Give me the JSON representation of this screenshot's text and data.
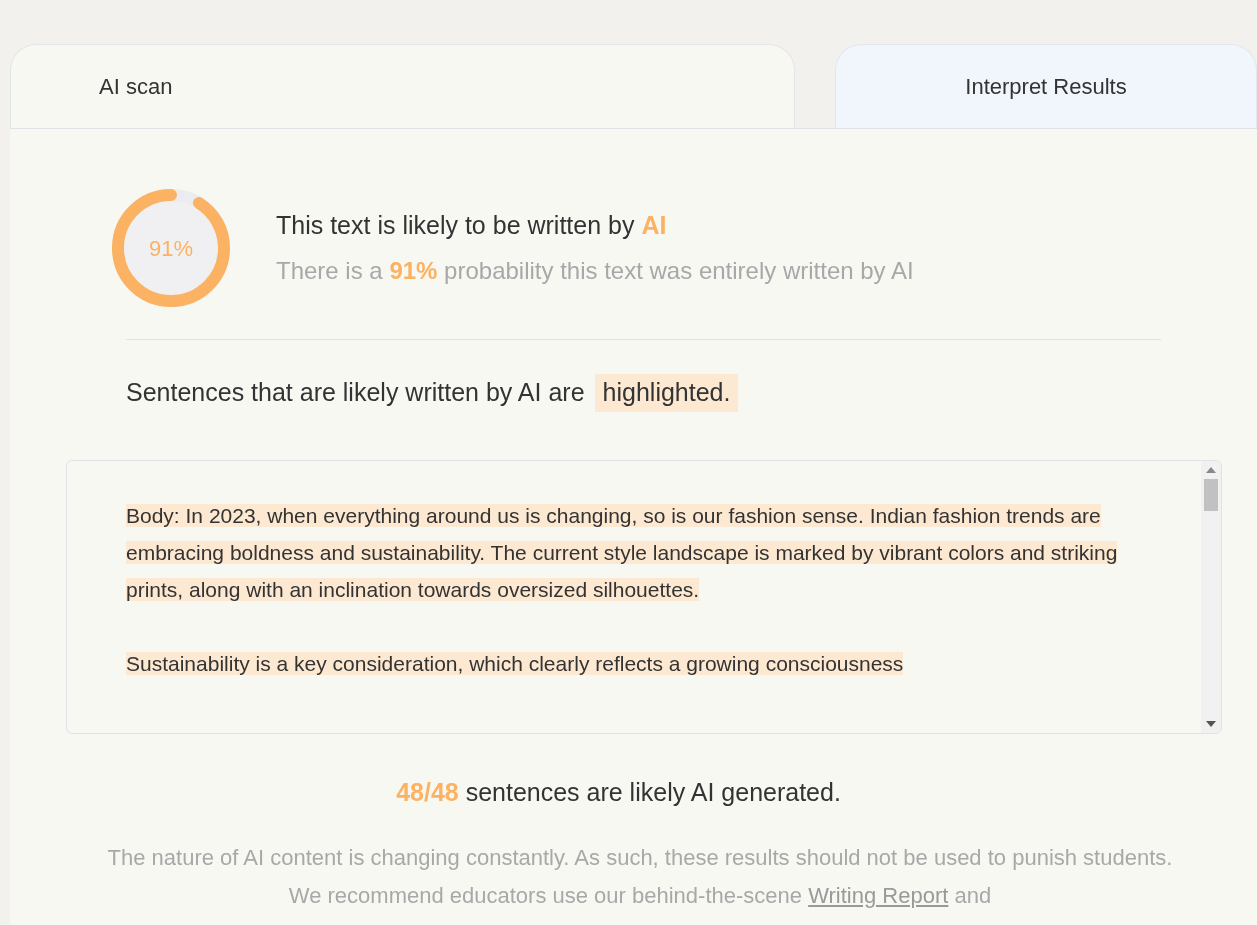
{
  "tabs": [
    {
      "label": "AI scan",
      "selected": true
    },
    {
      "label": "Interpret Results",
      "selected": false
    }
  ],
  "result": {
    "gauge": {
      "label": "91%",
      "level": 0.91
    },
    "headline": "This text is likely to be written by **AI**",
    "subline": "There is a **91%** probability this text was entirely written by AI"
  },
  "legend": {
    "text": "Sentences that are likely written by AI are",
    "highlight": "highlighted."
  },
  "scan_text": [
    {
      "text": "Body: In 2023, when everything around us is changing, so is our fashion sense. Indian fashion trends are embracing boldness and sustainability. The current style landscape is marked by vibrant colors and striking prints, along with an inclination towards oversized silhouettes.",
      "highlighted": true
    },
    {
      "text": "Sustainability is a key consideration, which clearly reflects a growing consciousness",
      "highlighted": true
    }
  ],
  "summary": "**48/48** sentences are likely AI generated.",
  "disclaimer": {
    "before": "The nature of AI content is changing constantly. As such, these results should not be used to punish students. We recommend educators use our behind-the-scene",
    "link": "Writing Report",
    "after": "and"
  }
}
